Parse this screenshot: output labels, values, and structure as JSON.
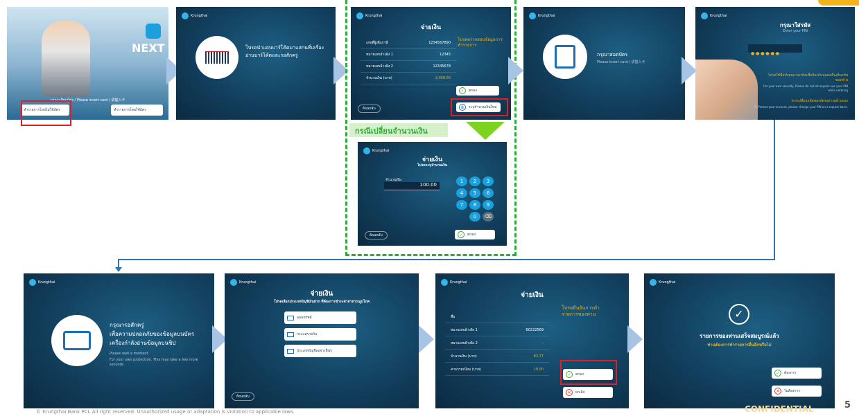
{
  "brand": {
    "logo_name": "Krungthai",
    "logo_sub": "กรุงไทย"
  },
  "s1": {
    "next_label": "NEXT",
    "insert": "กรุณาเสียบบัตร / Please insert card / 请插入卡",
    "btn_left_th": "ทำรายการโดยไม่ใช้บัตร",
    "btn_left_en": "Cardless",
    "btn_right_th": "ทำรายการโดยใช้บัตร",
    "btn_right_en": "Cardless ATM"
  },
  "s2": {
    "text": "โปรดนำแถบบาร์โค้ดมาแสกนที่เครื่องอ่านบาร์โค้ดและรอสักครู่"
  },
  "s3": {
    "title": "จ่ายเงิน",
    "rows": [
      {
        "label": "เลขที่ผู้เสียภาษี",
        "value": "1234567890"
      },
      {
        "label": "หมายเลขอ้างอิง 1",
        "value": "12345"
      },
      {
        "label": "หมายเลขอ้างอิง 2",
        "value": "12345678"
      },
      {
        "label": "จำนวนเงิน (บาท)",
        "value": "2,000.00"
      }
    ],
    "note": "โปรดตรวจสอบข้อมูลการทำรายการ",
    "confirm": "ตกลง",
    "change": "ระบุจำนวนเงินใหม่",
    "back": "ย้อนกลับ"
  },
  "s3b": {
    "case_label": "กรณีเปลี่ยนจำนวนเงิน",
    "title": "จ่ายเงิน",
    "subtitle": "โปรดระบุจำนวนเงิน",
    "field_label": "จำนวนเงิน",
    "amount": "100.00",
    "keys": [
      "1",
      "2",
      "3",
      "4",
      "5",
      "6",
      "7",
      "8",
      "9",
      "",
      "0",
      "⌫"
    ],
    "confirm": "ตกลง",
    "back": "ย้อนกลับ"
  },
  "s4": {
    "text": "กรุณาสอดบัตร",
    "sub": "Please insert card / 请插入卡"
  },
  "s5": {
    "title": "กรุณาใส่รหัส",
    "sub": "Enter your PIN",
    "pin": "● ● ● ● ● ●",
    "note1": "โปรดใช้มือบังขณะกดรหัสเพื่อป้องกันบุคคลอื่นเห็นรหัสของท่าน",
    "note1_en": "For your own security, Please do not let anyone see your PIN while entering",
    "note2": "ควรเปลี่ยนรหัสของบัตรอย่างสม่ำเสมอ",
    "note2_en": "To Protect your account, please change your PIN on a regular basis."
  },
  "s6": {
    "text1": "กรุณารอสักครู่",
    "text2": "เพื่อความปลอดภัยของข้อมูลบนบัตร",
    "text3": "เครื่องกำลังอ่านข้อมูลบนชิป",
    "en1": "Please wait a moment.",
    "en2": "For your own protection. This may take a few more seconds"
  },
  "s7": {
    "title": "จ่ายเงิน",
    "sub": "โปรดเลือกประเภทบัญชีเงินฝาก ที่ต้องการชำระค่าสาธารณูปโภค",
    "options": [
      "ออมทรัพย์",
      "กระแสรายวัน",
      "ประเภทบัญชีเฉพาะอื่นๆ"
    ],
    "back": "ย้อนกลับ"
  },
  "s8": {
    "title": "จ่ายเงิน",
    "rows": [
      {
        "label": "ชื่อ",
        "value": ""
      },
      {
        "label": "หมายเลขอ้างอิง 1",
        "value": "60222569"
      },
      {
        "label": "หมายเลขอ้างอิง 2",
        "value": "-"
      },
      {
        "label": "จำนวนเงิน (บาท)",
        "value": "63.77"
      },
      {
        "label": "ค่าธรรมเนียม (บาท)",
        "value": "10.00"
      }
    ],
    "note": "โปรดยืนยันการทำรายการของท่าน",
    "confirm": "ตกลง",
    "cancel": "ยกเลิก"
  },
  "s9": {
    "done": "รายการของท่านเสร็จสมบูรณ์แล้ว",
    "ask": "ท่านต้องการทำรายการอื่นอีกหรือไม่",
    "yes": "ต้องการ",
    "no": "ไม่ต้องการ"
  },
  "footer": {
    "copyright": "© Krungthai Bank PCL All right reserved. Unauthorized usage or adaptation is violation to applicable laws.",
    "confidential": "CONFIDENTIAL",
    "page": "5"
  }
}
